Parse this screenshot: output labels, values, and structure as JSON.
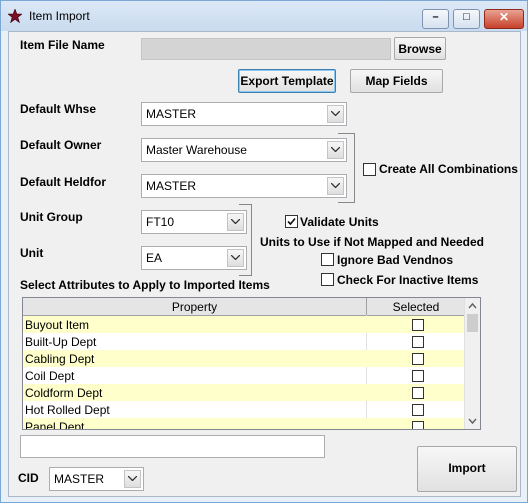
{
  "window": {
    "title": "Item Import",
    "icon": "star-icon",
    "controls": {
      "minimize": "–",
      "maximize": "□",
      "close": "✕"
    }
  },
  "item_file": {
    "label": "Item File Name",
    "value": "",
    "browse_label": "Browse"
  },
  "buttons": {
    "export_template": "Export Template",
    "map_fields": "Map Fields",
    "import": "Import"
  },
  "defaults": {
    "whse": {
      "label": "Default Whse",
      "value": "MASTER"
    },
    "owner": {
      "label": "Default Owner",
      "value": "Master Warehouse"
    },
    "heldfor": {
      "label": "Default Heldfor",
      "value": "MASTER"
    },
    "create_all_combinations": {
      "label": "Create All Combinations",
      "checked": false
    }
  },
  "units": {
    "group": {
      "label": "Unit Group",
      "value": "FT10"
    },
    "unit": {
      "label": "Unit",
      "value": "EA"
    },
    "validate_units": {
      "label": "Validate Units",
      "checked": true
    },
    "note": "Units to Use if Not Mapped and Needed",
    "ignore_bad_vendnos": {
      "label": "Ignore Bad Vendnos",
      "checked": false
    },
    "check_inactive": {
      "label": "Check For Inactive Items",
      "checked": false
    }
  },
  "attributes": {
    "label": "Select Attributes to Apply to Imported Items",
    "columns": [
      "Property",
      "Selected"
    ],
    "rows": [
      {
        "property": "Buyout Item",
        "selected": false
      },
      {
        "property": "Built-Up Dept",
        "selected": false
      },
      {
        "property": "Cabling Dept",
        "selected": false
      },
      {
        "property": "Coil Dept",
        "selected": false
      },
      {
        "property": "Coldform Dept",
        "selected": false
      },
      {
        "property": "Hot Rolled Dept",
        "selected": false
      },
      {
        "property": "Panel Dept",
        "selected": false
      }
    ]
  },
  "status": {
    "value": ""
  },
  "cid": {
    "label": "CID",
    "value": "MASTER"
  },
  "colors": {
    "row_highlight": "#ffffcc",
    "accent": "#3c7fb1",
    "close": "#c7412b"
  }
}
